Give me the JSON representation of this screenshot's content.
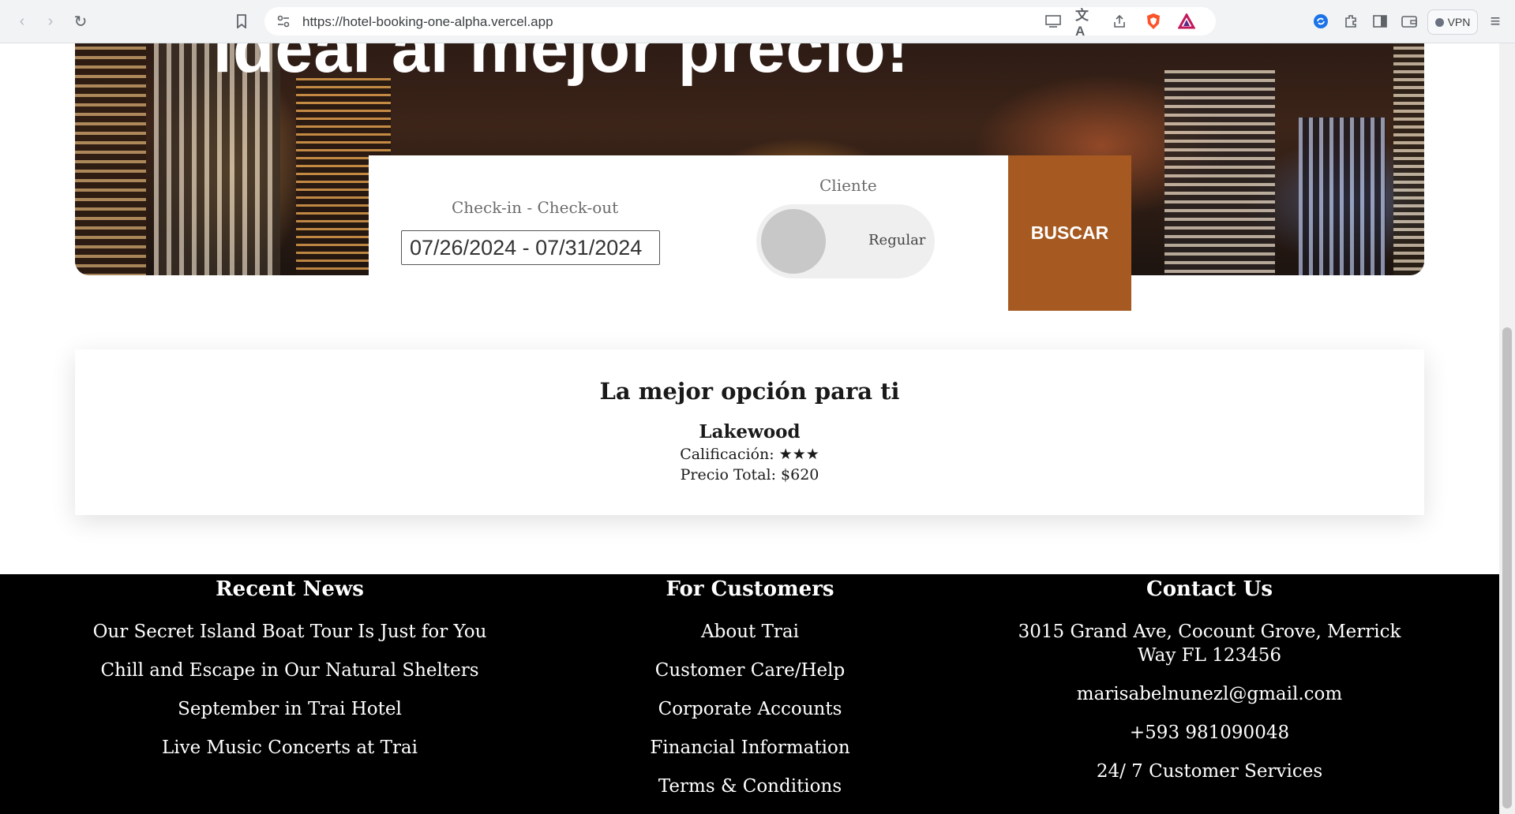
{
  "browser": {
    "url": "https://hotel-booking-one-alpha.vercel.app",
    "vpn_label": "VPN"
  },
  "hero": {
    "title": "ideal al mejor precio!"
  },
  "search": {
    "dates_label": "Check-in - Check-out",
    "dates_value": "07/26/2024 - 07/31/2024",
    "client_label": "Cliente",
    "client_toggle_label": "Regular",
    "button_label": "BUSCAR"
  },
  "best_option": {
    "title": "La mejor opción para ti",
    "hotel_name": "Lakewood",
    "rating_text": "Calificación: ★★★",
    "price_text": "Precio Total: $620"
  },
  "footer": {
    "news": {
      "title": "Recent News",
      "items": [
        "Our Secret Island Boat Tour Is Just for You",
        "Chill and Escape in Our Natural Shelters",
        "September in Trai Hotel",
        "Live Music Concerts at Trai"
      ]
    },
    "customers": {
      "title": "For Customers",
      "items": [
        "About Trai",
        "Customer Care/Help",
        "Corporate Accounts",
        "Financial Information",
        "Terms & Conditions"
      ]
    },
    "contact": {
      "title": "Contact Us",
      "items": [
        "3015 Grand Ave, Cocount Grove, Merrick Way FL 123456",
        "marisabelnunezl@gmail.com",
        "+593 981090048",
        "24/ 7 Customer Services"
      ]
    }
  },
  "colors": {
    "accent": "#a65a22",
    "footer_bg": "#000000"
  }
}
